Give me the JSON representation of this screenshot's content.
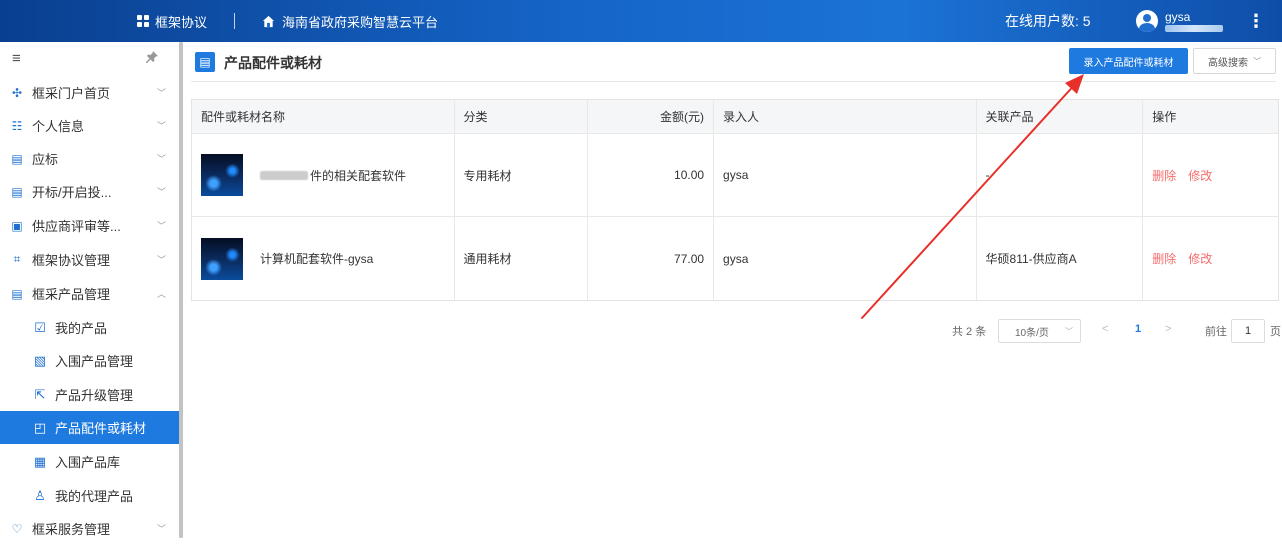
{
  "header": {
    "apps_label": "框架协议",
    "platform_label": "海南省政府采购智慧云平台",
    "online_users": "在线用户数: 5",
    "username": "gysa"
  },
  "sidebar": {
    "toggle_icon": "≡",
    "pin_icon": "📌",
    "items": [
      {
        "label": "框采门户首页",
        "icon": "grid-icon"
      },
      {
        "label": "个人信息",
        "icon": "user-card-icon"
      },
      {
        "label": "应标",
        "icon": "bid-icon"
      },
      {
        "label": "开标/开启投...",
        "icon": "open-bid-icon"
      },
      {
        "label": "供应商评审等...",
        "icon": "review-icon"
      },
      {
        "label": "框架协议管理",
        "icon": "agreement-icon"
      },
      {
        "label": "框采产品管理",
        "icon": "product-icon"
      },
      {
        "label": "我的产品",
        "icon": "my-product-icon"
      },
      {
        "label": "入围产品管理",
        "icon": "shortlist-icon"
      },
      {
        "label": "产品升级管理",
        "icon": "upgrade-icon"
      },
      {
        "label": "产品配件或耗材",
        "icon": "accessory-icon"
      },
      {
        "label": "入围产品库",
        "icon": "library-icon"
      },
      {
        "label": "我的代理产品",
        "icon": "agent-icon"
      },
      {
        "label": "框采服务管理",
        "icon": "service-icon"
      }
    ]
  },
  "main": {
    "title": "产品配件或耗材",
    "add_button": "录入产品配件或耗材",
    "advanced_search": "高级搜索",
    "table": {
      "headers": [
        "配件或耗材名称",
        "分类",
        "金额(元)",
        "录入人",
        "关联产品",
        "操作"
      ],
      "rows": [
        {
          "name": "件的相关配套软件",
          "category": "专用耗材",
          "amount": "10.00",
          "entered_by": "gysa",
          "product": "-",
          "delete": "删除",
          "edit": "修改"
        },
        {
          "name": "计算机配套软件-gysa",
          "category": "通用耗材",
          "amount": "77.00",
          "entered_by": "gysa",
          "product": "华硕811-供应商A",
          "delete": "删除",
          "edit": "修改"
        }
      ]
    },
    "pagination": {
      "total": "共 2 条",
      "page_size": "10条/页",
      "prev": "<",
      "current": "1",
      "next": ">",
      "goto_label": "前往",
      "goto_value": "1",
      "page_suffix": "页"
    }
  },
  "colors": {
    "header_blue": "#1565c8",
    "primary": "#1f7ae0",
    "danger": "#f56c6c",
    "annotation_arrow": "#e8302a"
  }
}
